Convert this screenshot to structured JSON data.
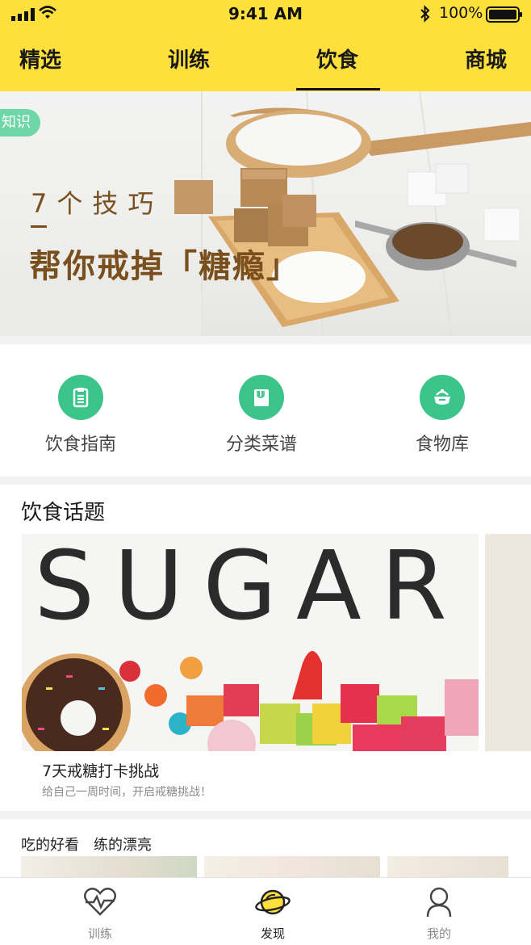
{
  "status_bar": {
    "time": "9:41 AM",
    "battery": "100%"
  },
  "tabs": [
    {
      "label": "精选"
    },
    {
      "label": "训练"
    },
    {
      "label": "饮食"
    },
    {
      "label": "商城"
    }
  ],
  "banner": {
    "tag": "知识",
    "line1": "7个技巧",
    "line2": "帮你戒掉「糖瘾」"
  },
  "shortcuts": [
    {
      "label": "饮食指南",
      "icon": "clipboard-icon"
    },
    {
      "label": "分类菜谱",
      "icon": "recipe-book-icon"
    },
    {
      "label": "食物库",
      "icon": "food-bowl-icon"
    }
  ],
  "topics": {
    "title": "饮食话题",
    "card": {
      "image_text": "SUGAR",
      "title": "7天戒糖打卡挑战",
      "subtitle": "给自己一周时间，开启戒糖挑战！"
    }
  },
  "section2": {
    "title": "吃的好看　练的漂亮"
  },
  "bottom_nav": [
    {
      "label": "训练",
      "icon": "heartbeat-icon"
    },
    {
      "label": "发现",
      "icon": "planet-icon"
    },
    {
      "label": "我的",
      "icon": "user-icon"
    }
  ],
  "colors": {
    "brand_yellow": "#fde03c",
    "accent_green": "#3cc58b",
    "tag_green": "#6fd6a8",
    "banner_text": "#7a4f1e"
  }
}
